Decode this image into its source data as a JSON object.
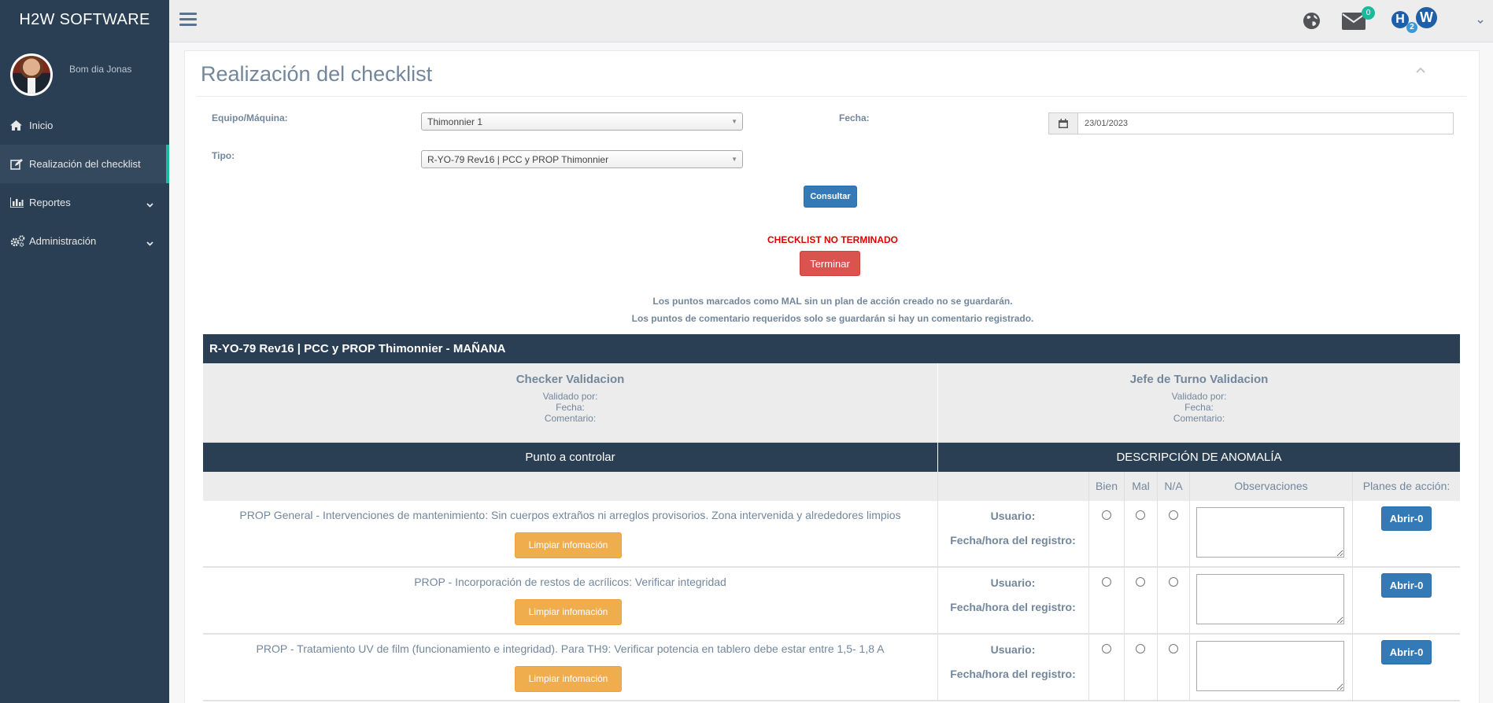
{
  "app": {
    "brand": "H2W SOFTWARE",
    "greeting": "Bom dia Jonas"
  },
  "sidebar": {
    "items": [
      {
        "label": "Inicio",
        "icon": "home-icon"
      },
      {
        "label": "Realización del checklist",
        "icon": "edit-icon",
        "active": true
      },
      {
        "label": "Reportes",
        "icon": "bar-chart-icon",
        "has_submenu": true
      },
      {
        "label": "Administración",
        "icon": "cogs-icon",
        "has_submenu": true
      }
    ]
  },
  "topbar": {
    "notification_count": "0"
  },
  "colors": {
    "sidebar": "#2a3f54",
    "accent": "#1abb9c",
    "primary": "#337ab7",
    "danger": "#d9534f",
    "warning": "#f0ad4e"
  },
  "page": {
    "title": "Realización del checklist"
  },
  "form": {
    "equipo_label": "Equipo/Máquina:",
    "equipo_value": "Thimonnier 1",
    "tipo_label": "Tipo:",
    "tipo_value": "R-YO-79 Rev16 | PCC y PROP Thimonnier",
    "fecha_label": "Fecha:",
    "fecha_value": "23/01/2023",
    "consultar_label": "Consultar"
  },
  "status": {
    "text": "CHECKLIST NO TERMINADO",
    "terminar_label": "Terminar",
    "note1": "Los puntos marcados como MAL sin un plan de acción creado no se guardarán.",
    "note2": "Los puntos de comentario requeridos solo se guardarán si hay un comentario registrado."
  },
  "checklist": {
    "title": "R-YO-79 Rev16 | PCC y PROP Thimonnier - MAÑANA",
    "checker": {
      "title": "Checker Validacion",
      "validado": "Validado por:",
      "fecha": "Fecha:",
      "comentario": "Comentario:"
    },
    "jefe": {
      "title": "Jefe de Turno Validacion",
      "validado": "Validado por:",
      "fecha": "Fecha:",
      "comentario": "Comentario:"
    },
    "col_punto": "Punto a controlar",
    "col_anomalia": "DESCRIPCIÓN DE ANOMALÍA",
    "sub_bien": "Bien",
    "sub_mal": "Mal",
    "sub_na": "N/A",
    "sub_obs": "Observaciones",
    "sub_planes": "Planes de acción:",
    "usuario_label": "Usuario:",
    "fechahora_label": "Fecha/hora del registro:",
    "limpiar_label": "Limpiar infomación",
    "rows": [
      {
        "text": "PROP General - Intervenciones de mantenimiento: Sin cuerpos extraños ni arreglos provisorios. Zona intervenida y alrededores limpios",
        "plan_label": "Abrir-0"
      },
      {
        "text": "PROP - Incorporación de restos de acrílicos: Verificar integridad",
        "plan_label": "Abrir-0"
      },
      {
        "text": "PROP - Tratamiento UV de film (funcionamiento e integridad). Para TH9: Verificar potencia en tablero debe estar entre 1,5- 1,8 A",
        "plan_label": "Abrir-0"
      }
    ]
  }
}
